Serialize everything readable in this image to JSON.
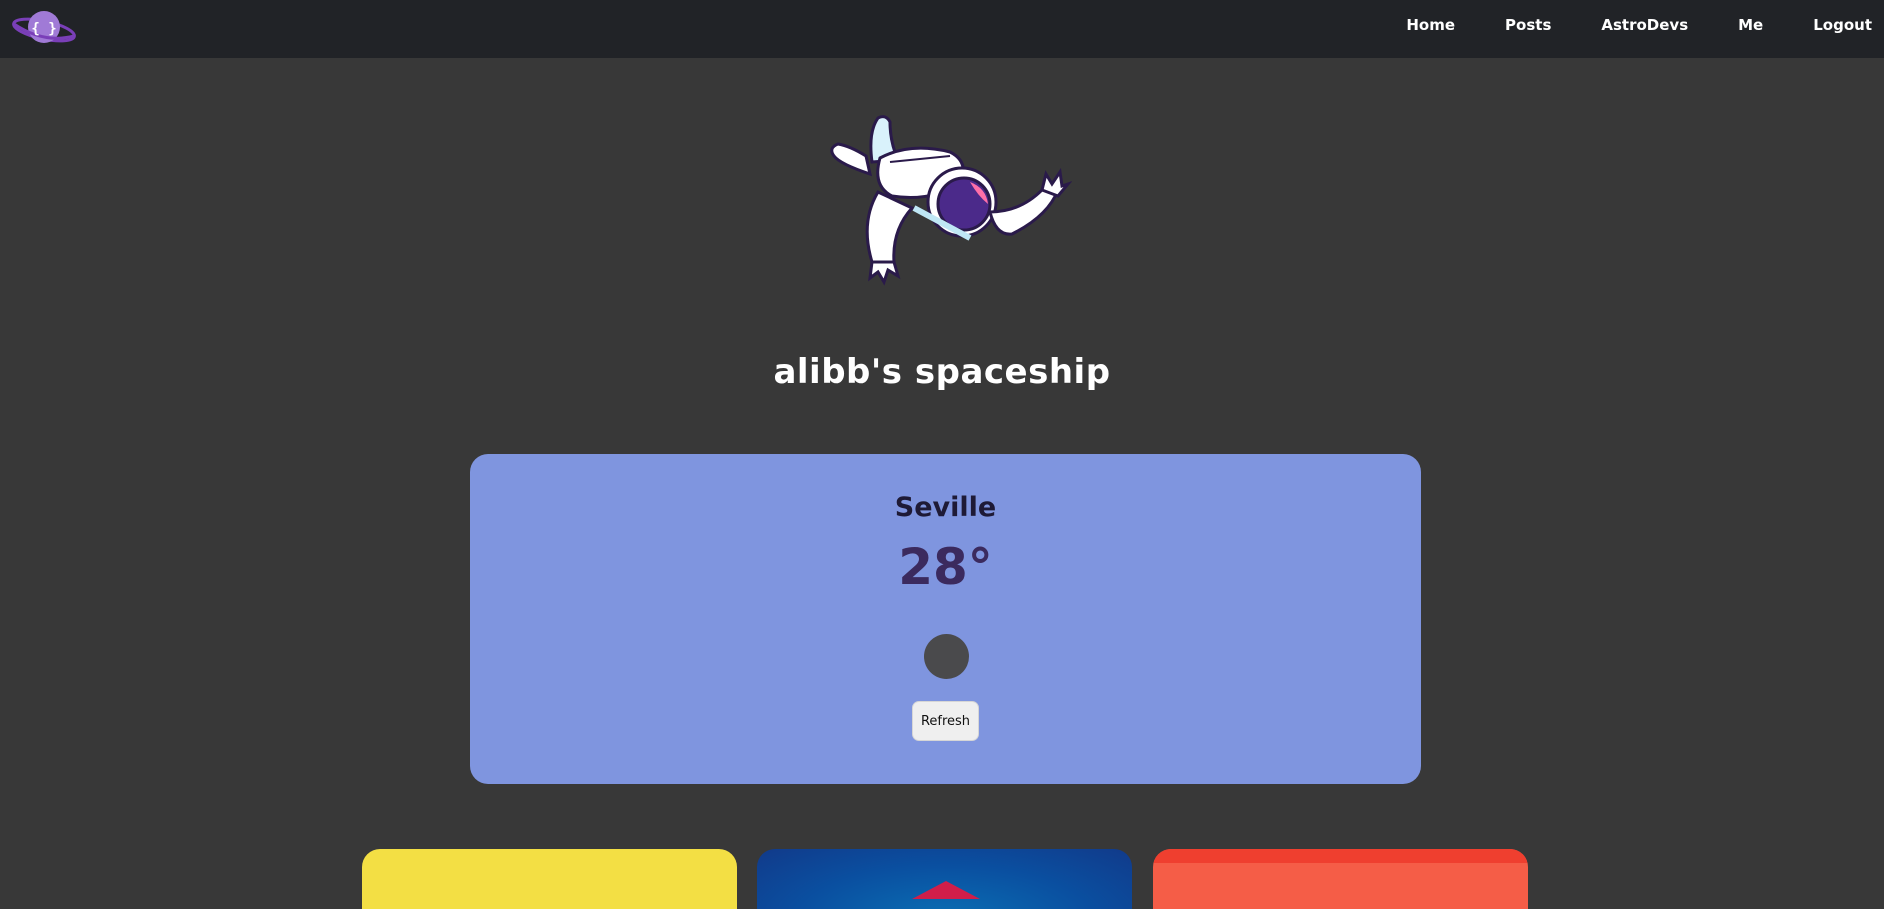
{
  "navbar": {
    "logo_glyph": "{ }",
    "links": [
      "Home",
      "Posts",
      "AstroDevs",
      "Me",
      "Logout"
    ]
  },
  "hero": {
    "username": "alibb",
    "title_suffix": "'s spaceship"
  },
  "weather": {
    "city": "Seville",
    "temperature": "28°",
    "refresh_label": "Refresh"
  },
  "colors": {
    "background": "#383838",
    "navbar": "#212327",
    "weather_card": "#7f95df",
    "tile_yellow": "#f3df44",
    "tile_blue": "#0a4fa0",
    "tile_red": "#f55d47"
  }
}
